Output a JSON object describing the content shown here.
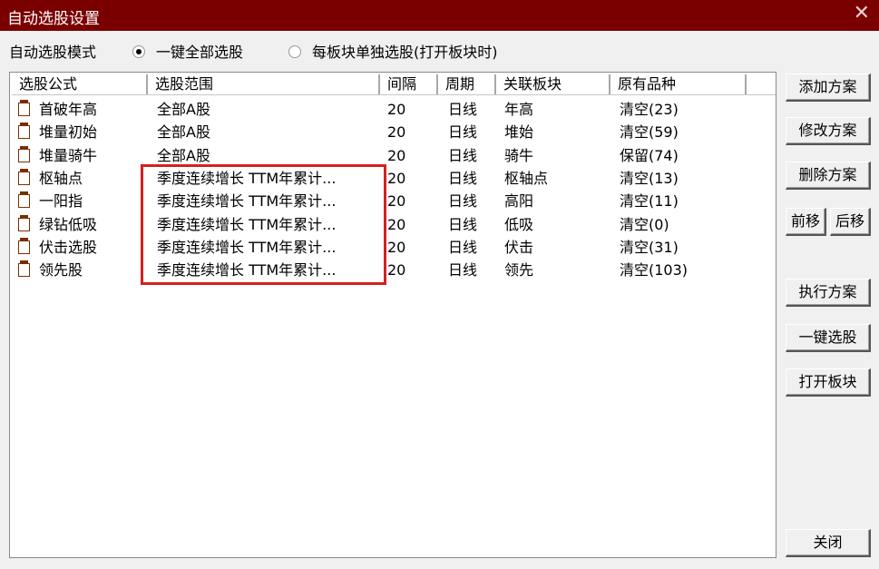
{
  "window": {
    "title": "自动选股设置",
    "close_glyph": "✕"
  },
  "mode": {
    "label": "自动选股模式",
    "option_all": "一键全部选股",
    "option_each": "每板块单独选股(打开板块时)",
    "selected": "option_all"
  },
  "table": {
    "columns": [
      "选股公式",
      "选股范围",
      "间隔",
      "周期",
      "关联板块",
      "原有品种"
    ],
    "rows": [
      {
        "formula": "首破年高",
        "scope": "全部A股",
        "interval": "20",
        "period": "日线",
        "block": "年高",
        "original": "清空(23)"
      },
      {
        "formula": "堆量初始",
        "scope": "全部A股",
        "interval": "20",
        "period": "日线",
        "block": "堆始",
        "original": "清空(59)"
      },
      {
        "formula": "堆量骑牛",
        "scope": "全部A股",
        "interval": "20",
        "period": "日线",
        "block": "骑牛",
        "original": "保留(74)"
      },
      {
        "formula": "枢轴点",
        "scope": "季度连续增长 TTM年累计...",
        "interval": "20",
        "period": "日线",
        "block": "枢轴点",
        "original": "清空(13)"
      },
      {
        "formula": "一阳指",
        "scope": "季度连续增长 TTM年累计...",
        "interval": "20",
        "period": "日线",
        "block": "高阳",
        "original": "清空(11)"
      },
      {
        "formula": "绿钻低吸",
        "scope": "季度连续增长 TTM年累计...",
        "interval": "20",
        "period": "日线",
        "block": "低吸",
        "original": "清空(0)"
      },
      {
        "formula": "伏击选股",
        "scope": "季度连续增长 TTM年累计...",
        "interval": "20",
        "period": "日线",
        "block": "伏击",
        "original": "清空(31)"
      },
      {
        "formula": "领先股",
        "scope": "季度连续增长 TTM年累计...",
        "interval": "20",
        "period": "日线",
        "block": "领先",
        "original": "清空(103)"
      }
    ]
  },
  "buttons": {
    "add": "添加方案",
    "modify": "修改方案",
    "delete": "删除方案",
    "move_up": "前移",
    "move_down": "后移",
    "execute": "执行方案",
    "one_click": "一键选股",
    "open_block": "打开板块",
    "close": "关闭"
  },
  "colors": {
    "titlebar": "#7a0000",
    "highlight": "#d52020",
    "icon": "#7a2e00"
  }
}
